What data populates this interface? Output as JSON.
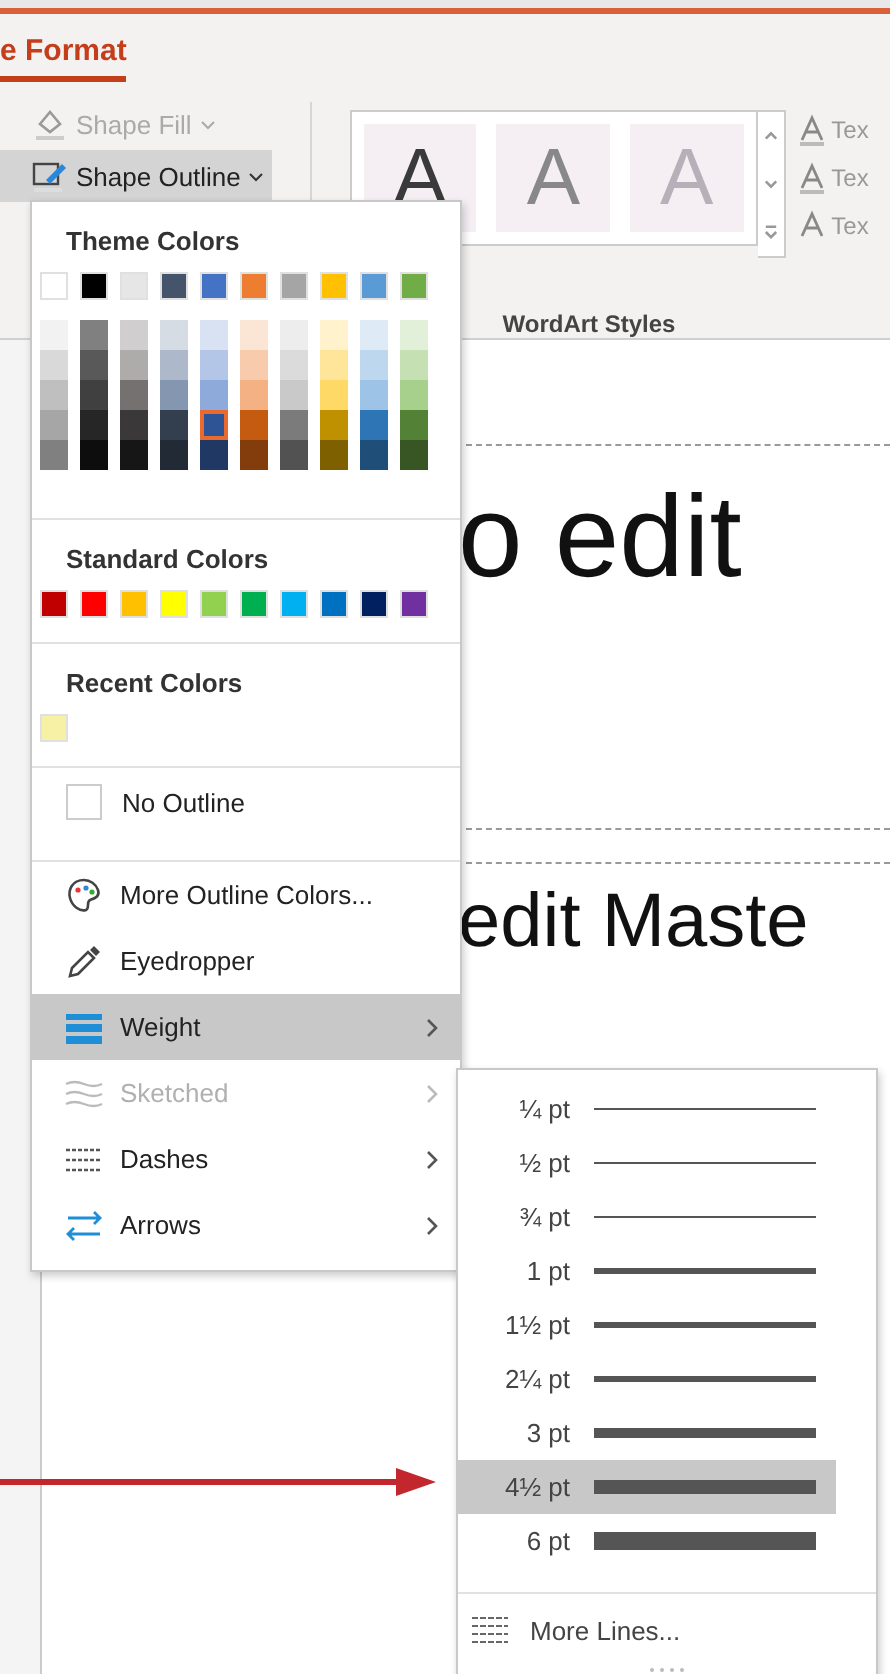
{
  "ribbon": {
    "tab": {
      "label": "e Format",
      "selected": true
    },
    "buttons": [
      {
        "label": "Shape Fill",
        "disabled": true,
        "selected": false
      },
      {
        "label": "Shape Outline",
        "disabled": false,
        "selected": true
      }
    ],
    "wordart_gallery": [
      "A",
      "A",
      "A"
    ],
    "text_buttons": [
      "Tex",
      "Tex",
      "Tex"
    ],
    "group_label": "WordArt Styles"
  },
  "slide": {
    "title_text": "o edit",
    "subtitle_text": "edit Maste"
  },
  "outline_menu": {
    "theme_heading": "Theme Colors",
    "theme_base": [
      {
        "color": "#ffffff",
        "selected": false
      },
      {
        "color": "#000000",
        "selected": false
      },
      {
        "color": "#e7e6e6",
        "selected": false
      },
      {
        "color": "#44546a",
        "selected": false
      },
      {
        "color": "#4472c4",
        "selected": false
      },
      {
        "color": "#ed7d31",
        "selected": false
      },
      {
        "color": "#a5a5a5",
        "selected": false
      },
      {
        "color": "#ffc000",
        "selected": false
      },
      {
        "color": "#5b9bd5",
        "selected": false
      },
      {
        "color": "#70ad47",
        "selected": false
      }
    ],
    "theme_shades": [
      {
        "shades": [
          {
            "color": "#f2f2f2",
            "selected": false
          },
          {
            "color": "#d9d9d9",
            "selected": false
          },
          {
            "color": "#bfbfbf",
            "selected": false
          },
          {
            "color": "#a6a6a6",
            "selected": false
          },
          {
            "color": "#808080",
            "selected": false
          }
        ]
      },
      {
        "shades": [
          {
            "color": "#808080",
            "selected": false
          },
          {
            "color": "#595959",
            "selected": false
          },
          {
            "color": "#404040",
            "selected": false
          },
          {
            "color": "#262626",
            "selected": false
          },
          {
            "color": "#0d0d0d",
            "selected": false
          }
        ]
      },
      {
        "shades": [
          {
            "color": "#d0cece",
            "selected": false
          },
          {
            "color": "#aeabab",
            "selected": false
          },
          {
            "color": "#757171",
            "selected": false
          },
          {
            "color": "#3a3838",
            "selected": false
          },
          {
            "color": "#171616",
            "selected": false
          }
        ]
      },
      {
        "shades": [
          {
            "color": "#d6dce4",
            "selected": false
          },
          {
            "color": "#adb9ca",
            "selected": false
          },
          {
            "color": "#8496b0",
            "selected": false
          },
          {
            "color": "#333f4f",
            "selected": false
          },
          {
            "color": "#222a35",
            "selected": false
          }
        ]
      },
      {
        "shades": [
          {
            "color": "#d9e2f3",
            "selected": false
          },
          {
            "color": "#b4c6e7",
            "selected": false
          },
          {
            "color": "#8eaadb",
            "selected": false
          },
          {
            "color": "#2f5496",
            "selected": true
          },
          {
            "color": "#1f3864",
            "selected": false
          }
        ]
      },
      {
        "shades": [
          {
            "color": "#fbe5d5",
            "selected": false
          },
          {
            "color": "#f7cbac",
            "selected": false
          },
          {
            "color": "#f4b183",
            "selected": false
          },
          {
            "color": "#c55a11",
            "selected": false
          },
          {
            "color": "#833c0b",
            "selected": false
          }
        ]
      },
      {
        "shades": [
          {
            "color": "#ededed",
            "selected": false
          },
          {
            "color": "#dbdbdb",
            "selected": false
          },
          {
            "color": "#c9c9c9",
            "selected": false
          },
          {
            "color": "#7b7b7b",
            "selected": false
          },
          {
            "color": "#525252",
            "selected": false
          }
        ]
      },
      {
        "shades": [
          {
            "color": "#fff2cc",
            "selected": false
          },
          {
            "color": "#ffe599",
            "selected": false
          },
          {
            "color": "#ffd966",
            "selected": false
          },
          {
            "color": "#bf9000",
            "selected": false
          },
          {
            "color": "#7f6000",
            "selected": false
          }
        ]
      },
      {
        "shades": [
          {
            "color": "#deebf6",
            "selected": false
          },
          {
            "color": "#bdd7ee",
            "selected": false
          },
          {
            "color": "#9dc3e6",
            "selected": false
          },
          {
            "color": "#2e75b5",
            "selected": false
          },
          {
            "color": "#1f4e79",
            "selected": false
          }
        ]
      },
      {
        "shades": [
          {
            "color": "#e2efd9",
            "selected": false
          },
          {
            "color": "#c5e0b3",
            "selected": false
          },
          {
            "color": "#a8d08d",
            "selected": false
          },
          {
            "color": "#538135",
            "selected": false
          },
          {
            "color": "#375623",
            "selected": false
          }
        ]
      }
    ],
    "standard_heading": "Standard Colors",
    "standard": [
      {
        "color": "#c00000",
        "selected": false
      },
      {
        "color": "#ff0000",
        "selected": false
      },
      {
        "color": "#ffc000",
        "selected": false
      },
      {
        "color": "#ffff00",
        "selected": false
      },
      {
        "color": "#92d050",
        "selected": false
      },
      {
        "color": "#00b050",
        "selected": false
      },
      {
        "color": "#00b0f0",
        "selected": false
      },
      {
        "color": "#0070c0",
        "selected": false
      },
      {
        "color": "#002060",
        "selected": false
      },
      {
        "color": "#7030a0",
        "selected": false
      }
    ],
    "recent_heading": "Recent Colors",
    "recent": [
      {
        "color": "#f7f1a6",
        "selected": false
      }
    ],
    "items": [
      {
        "kind": "checkbox",
        "label": "No Outline",
        "checked": false,
        "selected": false,
        "disabled": false,
        "submenu": false
      },
      {
        "kind": "command",
        "label": "More Outline Colors...",
        "selected": false,
        "disabled": false,
        "submenu": false
      },
      {
        "kind": "command",
        "label": "Eyedropper",
        "selected": false,
        "disabled": false,
        "submenu": false
      },
      {
        "kind": "command",
        "label": "Weight",
        "selected": true,
        "disabled": false,
        "submenu": true
      },
      {
        "kind": "command",
        "label": "Sketched",
        "selected": false,
        "disabled": true,
        "submenu": true
      },
      {
        "kind": "command",
        "label": "Dashes",
        "selected": false,
        "disabled": false,
        "submenu": true
      },
      {
        "kind": "command",
        "label": "Arrows",
        "selected": false,
        "disabled": false,
        "submenu": true
      }
    ]
  },
  "weight_menu": {
    "items": [
      {
        "label": "¼ pt",
        "selected": false
      },
      {
        "label": "½ pt",
        "selected": false
      },
      {
        "label": "¾ pt",
        "selected": false
      },
      {
        "label": "1 pt",
        "selected": false
      },
      {
        "label": "1½ pt",
        "selected": false
      },
      {
        "label": "2¼ pt",
        "selected": false
      },
      {
        "label": "3 pt",
        "selected": false
      },
      {
        "label": "4½ pt",
        "selected": true
      },
      {
        "label": "6 pt",
        "selected": false
      }
    ],
    "more_label": "More Lines..."
  }
}
